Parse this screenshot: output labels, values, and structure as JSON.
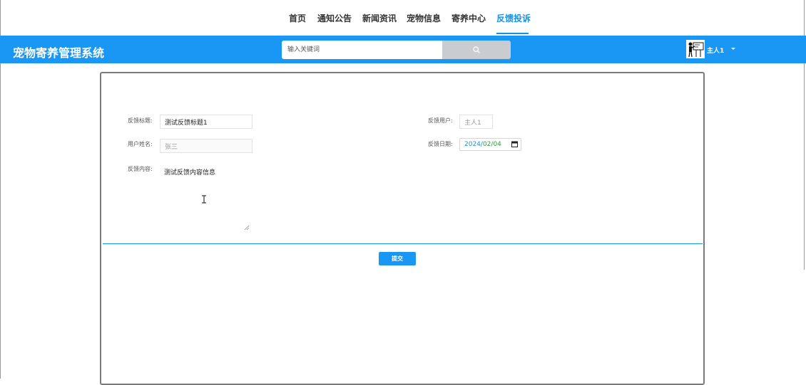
{
  "nav": {
    "items": [
      "首页",
      "通知公告",
      "新闻资讯",
      "宠物信息",
      "寄养中心",
      "反馈投诉"
    ],
    "active_index": 5
  },
  "header": {
    "brand": "宠物寄养管理系统",
    "search_placeholder": "输入关键词",
    "search_icon": "search-icon",
    "user": "主人1",
    "user_caret_icon": "caret-down-icon"
  },
  "form": {
    "title_label": "反馈标题:",
    "title_value": "测试反馈标题1",
    "user_label": "反馈用户:",
    "user_value": "主人1",
    "name_label": "用户姓名:",
    "name_value": "张三",
    "date_label": "反馈日期:",
    "date_year": "2024",
    "date_month": "02",
    "date_day": "04",
    "date_sep": "/",
    "content_label": "反馈内容:",
    "content_value": "测试反馈内容信息",
    "submit_label": "提交"
  },
  "colors": {
    "primary": "#1a97f5",
    "active_nav": "#1592e6",
    "search_button": "#c9ccd1"
  }
}
